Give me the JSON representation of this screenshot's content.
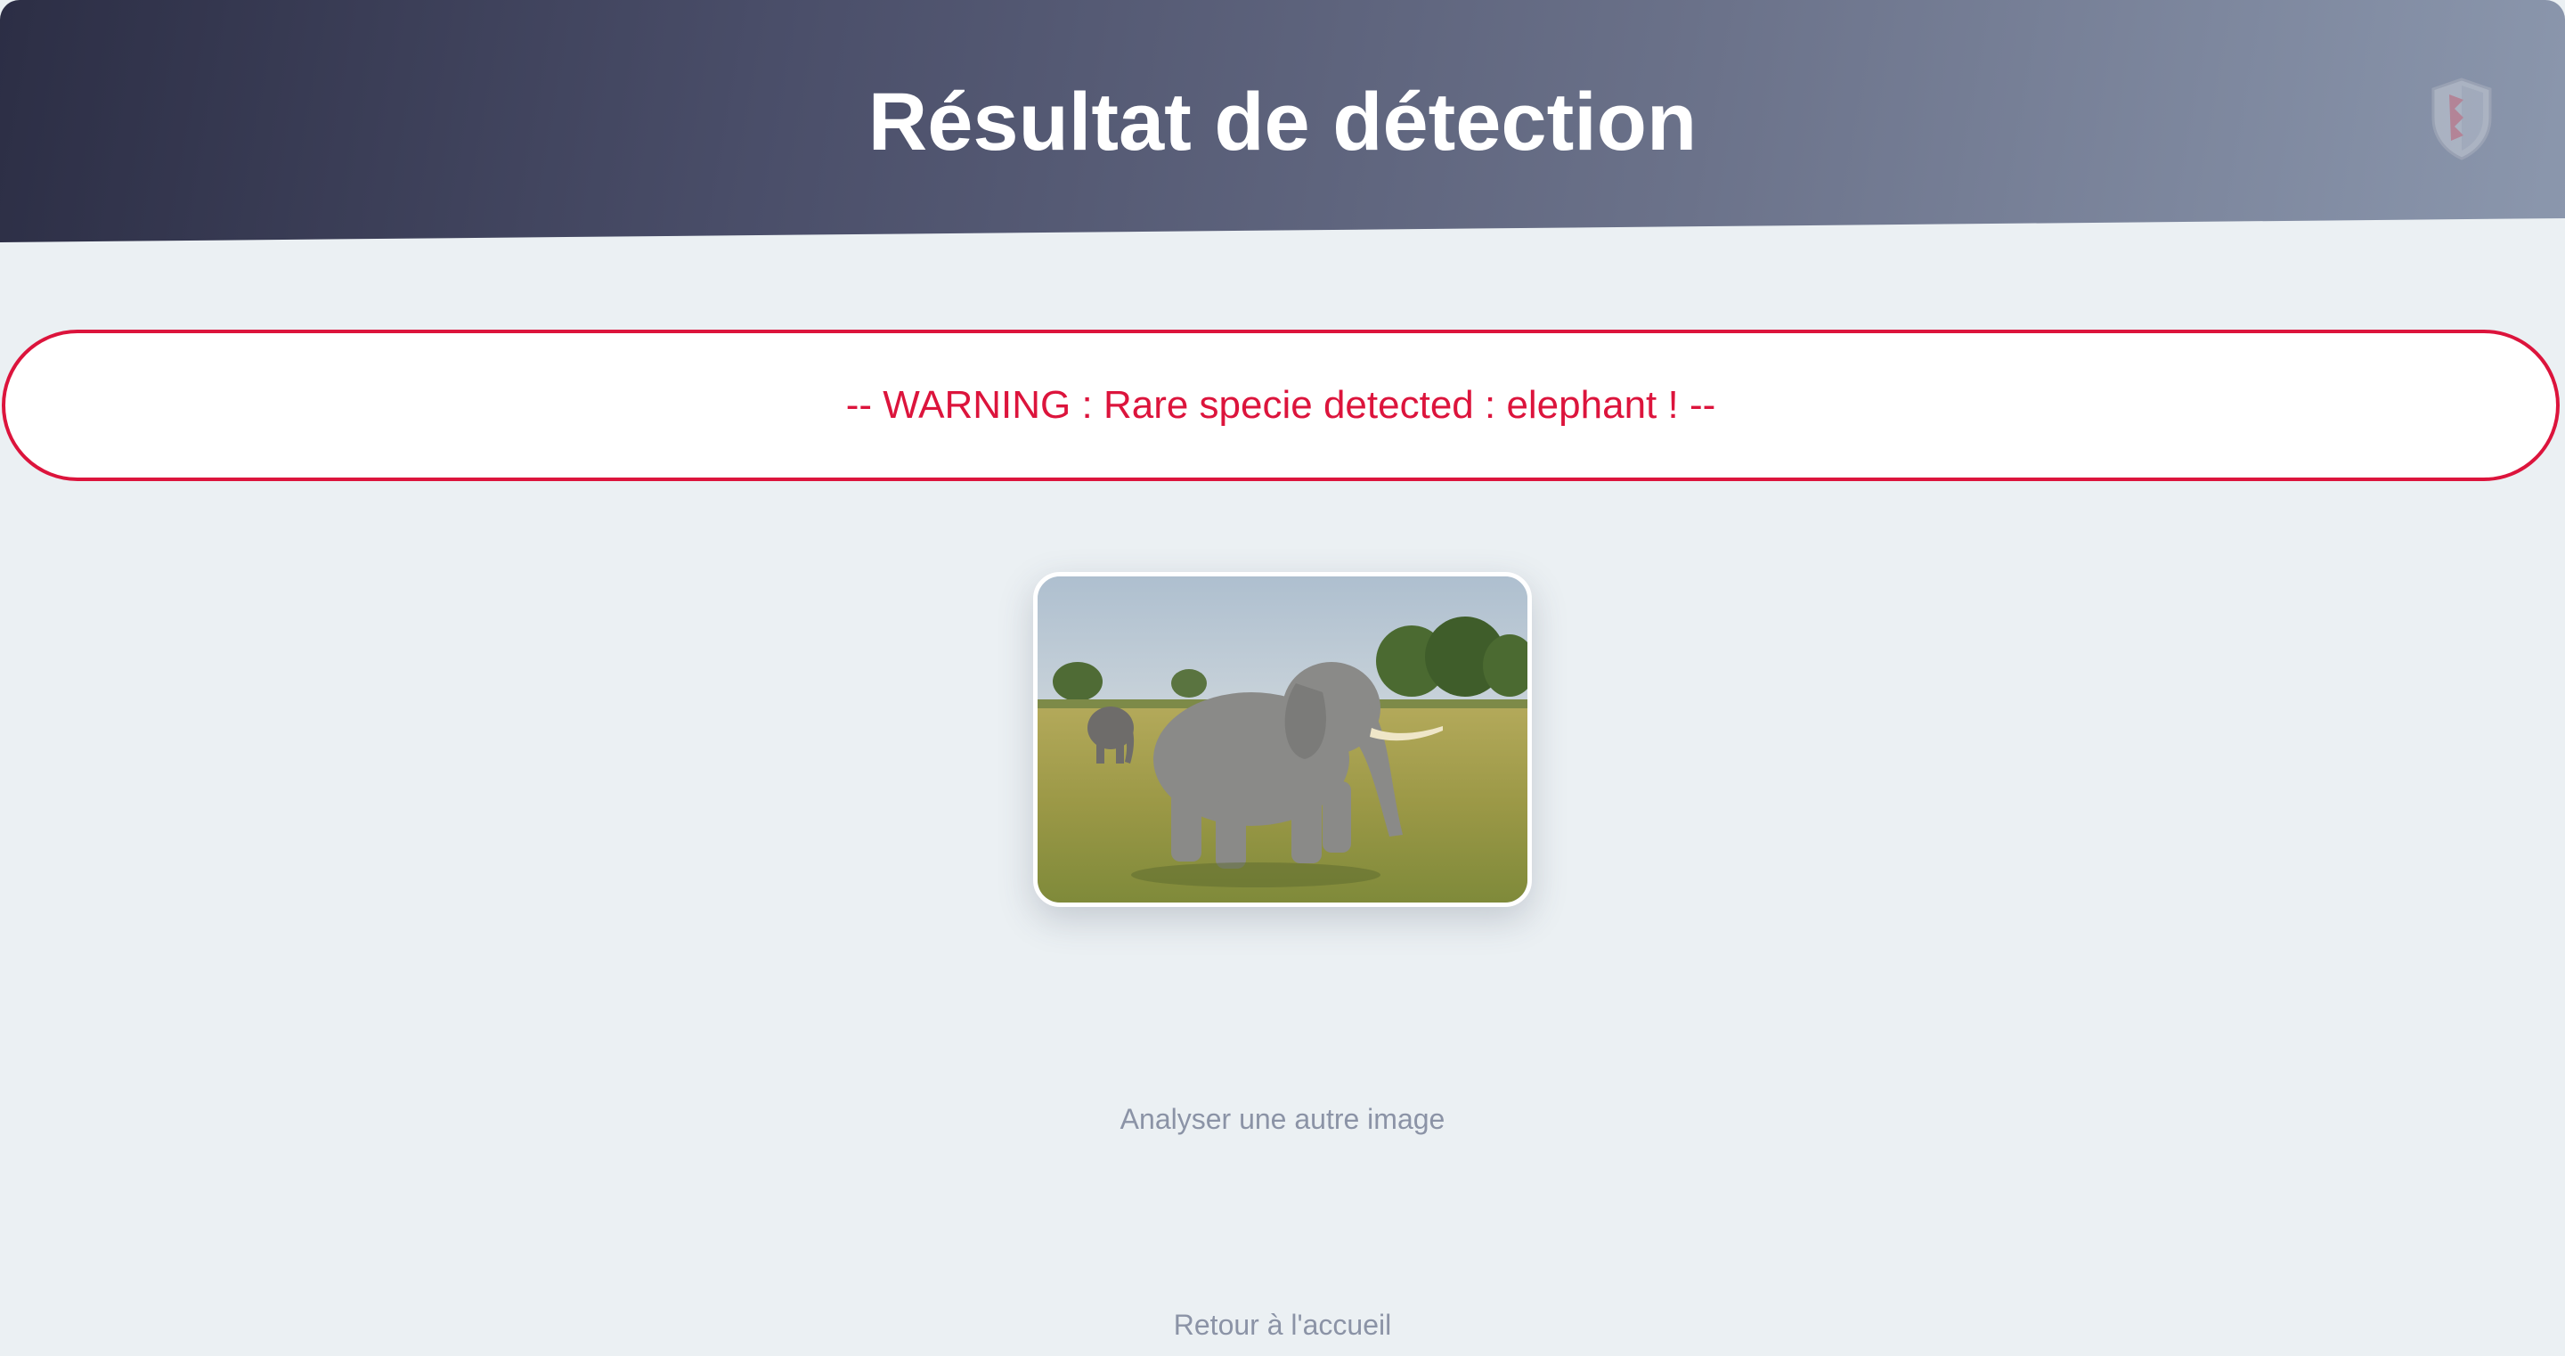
{
  "header": {
    "title": "Résultat de détection",
    "logo_icon": "shield-logo-icon",
    "gradient_colors": [
      "#2c2e45",
      "#8b97ad"
    ]
  },
  "warning": {
    "text": "-- WARNING : Rare specie detected : elephant ! --",
    "color": "#dc143c"
  },
  "result_image": {
    "subject": "elephant",
    "icon": "elephant-photo"
  },
  "actions": {
    "analyze_another": "Analyser une autre image",
    "back_home": "Retour à l'accueil"
  }
}
